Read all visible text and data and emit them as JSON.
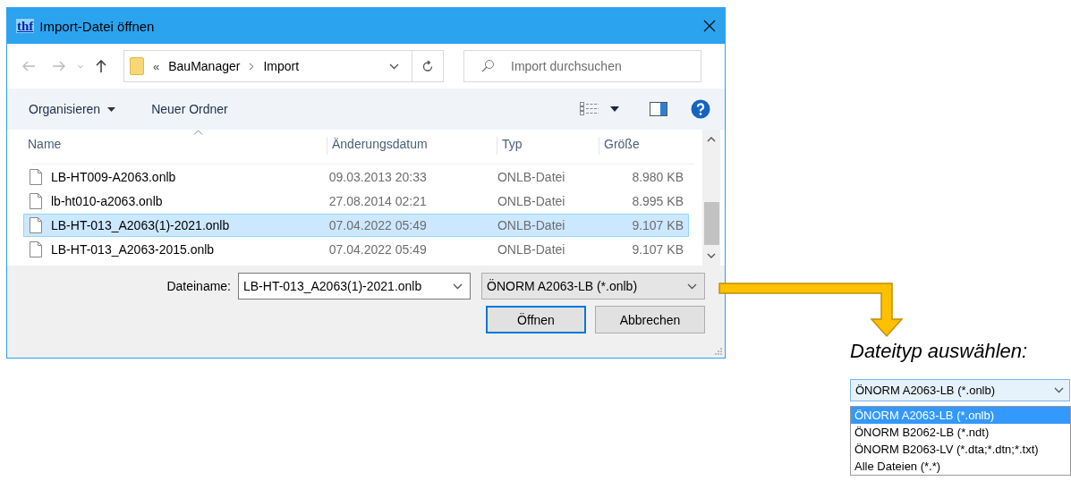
{
  "window": {
    "title": "Import-Datei öffnen",
    "app_logo": "thf"
  },
  "address_bar": {
    "overflow": "«",
    "path": [
      "BauManager",
      "Import"
    ]
  },
  "search": {
    "placeholder": "Import durchsuchen"
  },
  "toolbar": {
    "organize": "Organisieren",
    "new_folder": "Neuer Ordner"
  },
  "columns": [
    "Name",
    "Änderungsdatum",
    "Typ",
    "Größe"
  ],
  "rows": [
    {
      "name": "LB-HT009-A2063.onlb",
      "date": "09.03.2013 20:33",
      "type": "ONLB-Datei",
      "size": "8.980 KB",
      "selected": false
    },
    {
      "name": "lb-ht010-a2063.onlb",
      "date": "27.08.2014 02:21",
      "type": "ONLB-Datei",
      "size": "8.995 KB",
      "selected": false
    },
    {
      "name": "LB-HT-013_A2063(1)-2021.onlb",
      "date": "07.04.2022 05:49",
      "type": "ONLB-Datei",
      "size": "9.107 KB",
      "selected": true
    },
    {
      "name": "LB-HT-013_A2063-2015.onlb",
      "date": "07.04.2022 05:49",
      "type": "ONLB-Datei",
      "size": "9.107 KB",
      "selected": false
    }
  ],
  "footer": {
    "filename_label": "Dateiname:",
    "filename": "LB-HT-013_A2063(1)-2021.onlb",
    "filetype": "ÖNORM A2063-LB (*.onlb)",
    "buttons": [
      {
        "label": "Öffnen",
        "default": true
      },
      {
        "label": "Abbrechen",
        "default": false
      }
    ]
  },
  "callout": {
    "caption": "Dateityp auswählen:",
    "dropdown_value": "ÖNORM A2063-LB (*.onlb)",
    "options": [
      {
        "label": "ÖNORM A2063-LB (*.onlb)",
        "selected": true
      },
      {
        "label": "ÖNORM B2062-LB (*.ndt)",
        "selected": false
      },
      {
        "label": "ÖNORM B2063-LV (*.dta;*.dtn;*.txt)",
        "selected": false
      },
      {
        "label": "Alle Dateien (*.*)",
        "selected": false
      }
    ]
  }
}
